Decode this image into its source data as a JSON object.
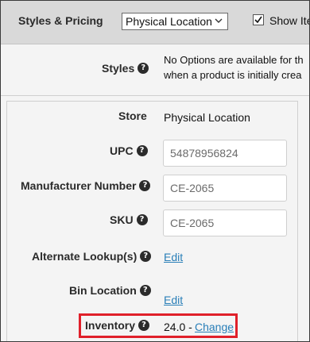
{
  "header": {
    "title": "Styles & Pricing",
    "location_select": "Physical Location",
    "show_items_label": "Show Ite"
  },
  "styles": {
    "label": "Styles",
    "note_line1": "No Options are available for th",
    "note_line2": "when a product is initially crea"
  },
  "details": {
    "store": {
      "label": "Store",
      "value": "Physical Location"
    },
    "upc": {
      "label": "UPC",
      "value": "54878956824"
    },
    "manufacturer_number": {
      "label": "Manufacturer Number",
      "value": "CE-2065"
    },
    "sku": {
      "label": "SKU",
      "value": "CE-2065"
    },
    "alternate_lookups": {
      "label": "Alternate Lookup(s)",
      "link": "Edit"
    },
    "bin_location": {
      "label": "Bin Location",
      "link": "Edit"
    },
    "inventory": {
      "label": "Inventory",
      "value": "24.0 -",
      "link": "Change"
    }
  },
  "icons": {
    "help": "question-circle-icon",
    "dropdown": "chevron-down-icon",
    "checkbox": "checkmark-icon"
  },
  "colors": {
    "highlight": "#e0202a",
    "link": "#2a7fb8",
    "header_bg": "#d9d9d9"
  }
}
